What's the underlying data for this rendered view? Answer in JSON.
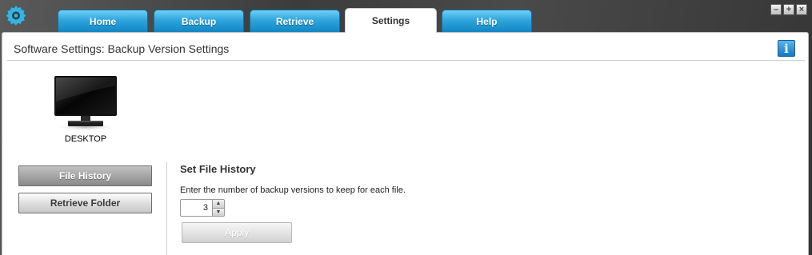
{
  "app": {
    "logo_icon": "gear-head-icon",
    "accent_color": "#2fa5dd"
  },
  "tabs": [
    {
      "label": "Home",
      "active": false
    },
    {
      "label": "Backup",
      "active": false
    },
    {
      "label": "Retrieve",
      "active": false
    },
    {
      "label": "Settings",
      "active": true
    },
    {
      "label": "Help",
      "active": false
    }
  ],
  "window_controls": [
    {
      "icon": "minimize-icon",
      "glyph": "–"
    },
    {
      "icon": "maximize-icon",
      "glyph": "+"
    },
    {
      "icon": "close-icon",
      "glyph": "×"
    }
  ],
  "panel": {
    "title": "Software Settings: Backup Version Settings",
    "info_icon": "info-icon",
    "info_glyph": "i"
  },
  "device": {
    "label": "DESKTOP",
    "icon": "monitor-icon"
  },
  "sidebar": {
    "items": [
      {
        "label": "File History",
        "active": true
      },
      {
        "label": "Retrieve Folder",
        "active": false
      }
    ]
  },
  "settings": {
    "section_title": "Set File History",
    "instruction": "Enter the number of backup versions to keep for each file.",
    "versions_value": "3",
    "up_glyph": "▲",
    "down_glyph": "▼",
    "apply_label": "Apply",
    "apply_enabled": false
  }
}
